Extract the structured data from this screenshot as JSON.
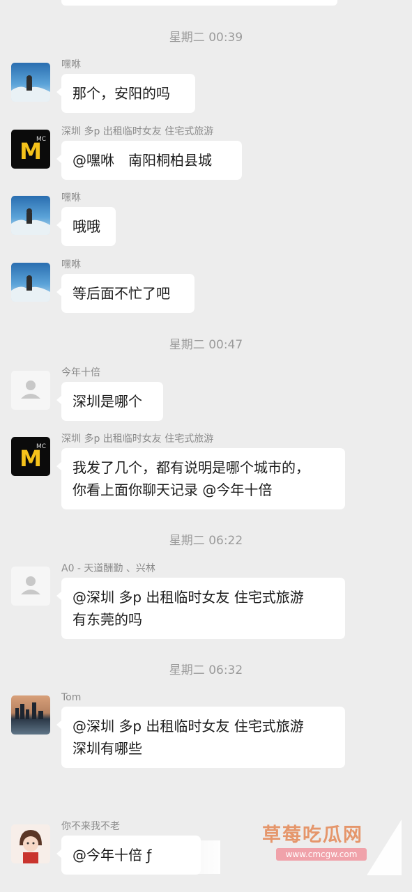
{
  "colors": {
    "background": "#ededed",
    "bubble": "#ffffff",
    "meta_text": "#9b9b9b",
    "watermark": "#e48855"
  },
  "timestamps": [
    "星期二 00:39",
    "星期二 00:47",
    "星期二 06:22",
    "星期二 06:32"
  ],
  "messages": [
    {
      "sender": "嘿咻",
      "text": "那个，安阳的吗",
      "avatar": "sky-avatar"
    },
    {
      "sender": "深圳 多p 出租临时女友 住宅式旅游",
      "text": "@嘿咻　南阳桐柏县城",
      "avatar": "mcdonalds-avatar"
    },
    {
      "sender": "嘿咻",
      "text": "哦哦",
      "avatar": "sky-avatar"
    },
    {
      "sender": "嘿咻",
      "text": "等后面不忙了吧",
      "avatar": "sky-avatar"
    },
    {
      "sender": "今年十倍",
      "text": "深圳是哪个",
      "avatar": "default-avatar"
    },
    {
      "sender": "深圳 多p 出租临时女友 住宅式旅游",
      "text": "我发了几个，都有说明是哪个城市的，\n你看上面你聊天记录 @今年十倍",
      "avatar": "mcdonalds-avatar"
    },
    {
      "sender": "A0 - 天道酬勤 、兴林",
      "text": "@深圳 多p 出租临时女友 住宅式旅游\n有东莞的吗",
      "avatar": "default-avatar"
    },
    {
      "sender": "Tom",
      "text": "@深圳 多p 出租临时女友 住宅式旅游\n深圳有哪些",
      "avatar": "city-avatar"
    },
    {
      "sender": "你不来我不老",
      "text": "@今年十倍 ƒ",
      "avatar": "girl-avatar"
    }
  ],
  "watermark": {
    "title": "草莓吃瓜网",
    "url": "www.cmcgw.com"
  }
}
